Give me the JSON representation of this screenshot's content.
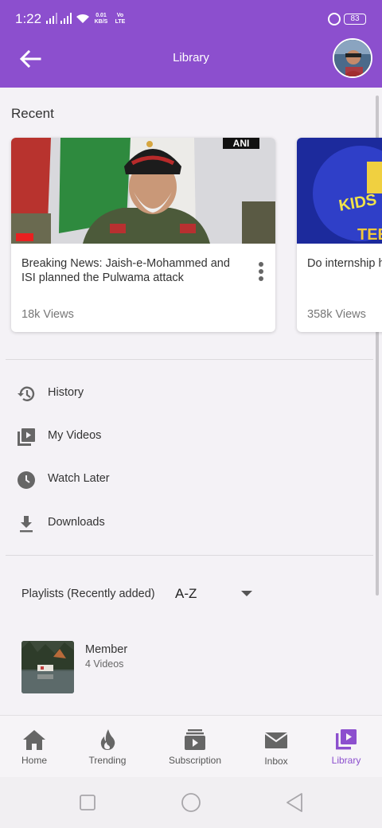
{
  "status_bar": {
    "time": "1:22",
    "net_speed_value": "0.01",
    "net_speed_unit": "KB/S",
    "volte_top": "Vo",
    "volte_bottom": "LTE",
    "battery": "83"
  },
  "app_bar": {
    "title": "Library",
    "back_icon": "arrow-left-icon",
    "avatar_icon": "user-avatar"
  },
  "recent": {
    "heading": "Recent",
    "videos": [
      {
        "title": "Breaking News: Jaish-e-Mohammed and ISI planned the Pulwama attack",
        "views": "18k Views",
        "watermark": "ANI"
      },
      {
        "title": "Do internship h",
        "views": "358k Views",
        "thumb_text_1": "KIDS",
        "thumb_text_2": "TEE"
      }
    ]
  },
  "menu": [
    {
      "label": "History",
      "icon": "history-icon"
    },
    {
      "label": "My Videos",
      "icon": "video-library-icon"
    },
    {
      "label": "Watch Later",
      "icon": "clock-icon"
    },
    {
      "label": "Downloads",
      "icon": "download-icon"
    }
  ],
  "playlists": {
    "heading": "Playlists (Recently added)",
    "sort_value": "A-Z",
    "items": [
      {
        "name": "Member",
        "count": "4 Videos"
      }
    ]
  },
  "bottom_nav": [
    {
      "label": "Home",
      "icon": "home-icon",
      "active": false
    },
    {
      "label": "Trending",
      "icon": "flame-icon",
      "active": false
    },
    {
      "label": "Subscription",
      "icon": "subscriptions-icon",
      "active": false
    },
    {
      "label": "Inbox",
      "icon": "mail-icon",
      "active": false
    },
    {
      "label": "Library",
      "icon": "video-library-icon",
      "active": true
    }
  ],
  "colors": {
    "primary": "#8c4fce",
    "active_nav": "#8c4fce",
    "inactive_nav": "#666666"
  }
}
